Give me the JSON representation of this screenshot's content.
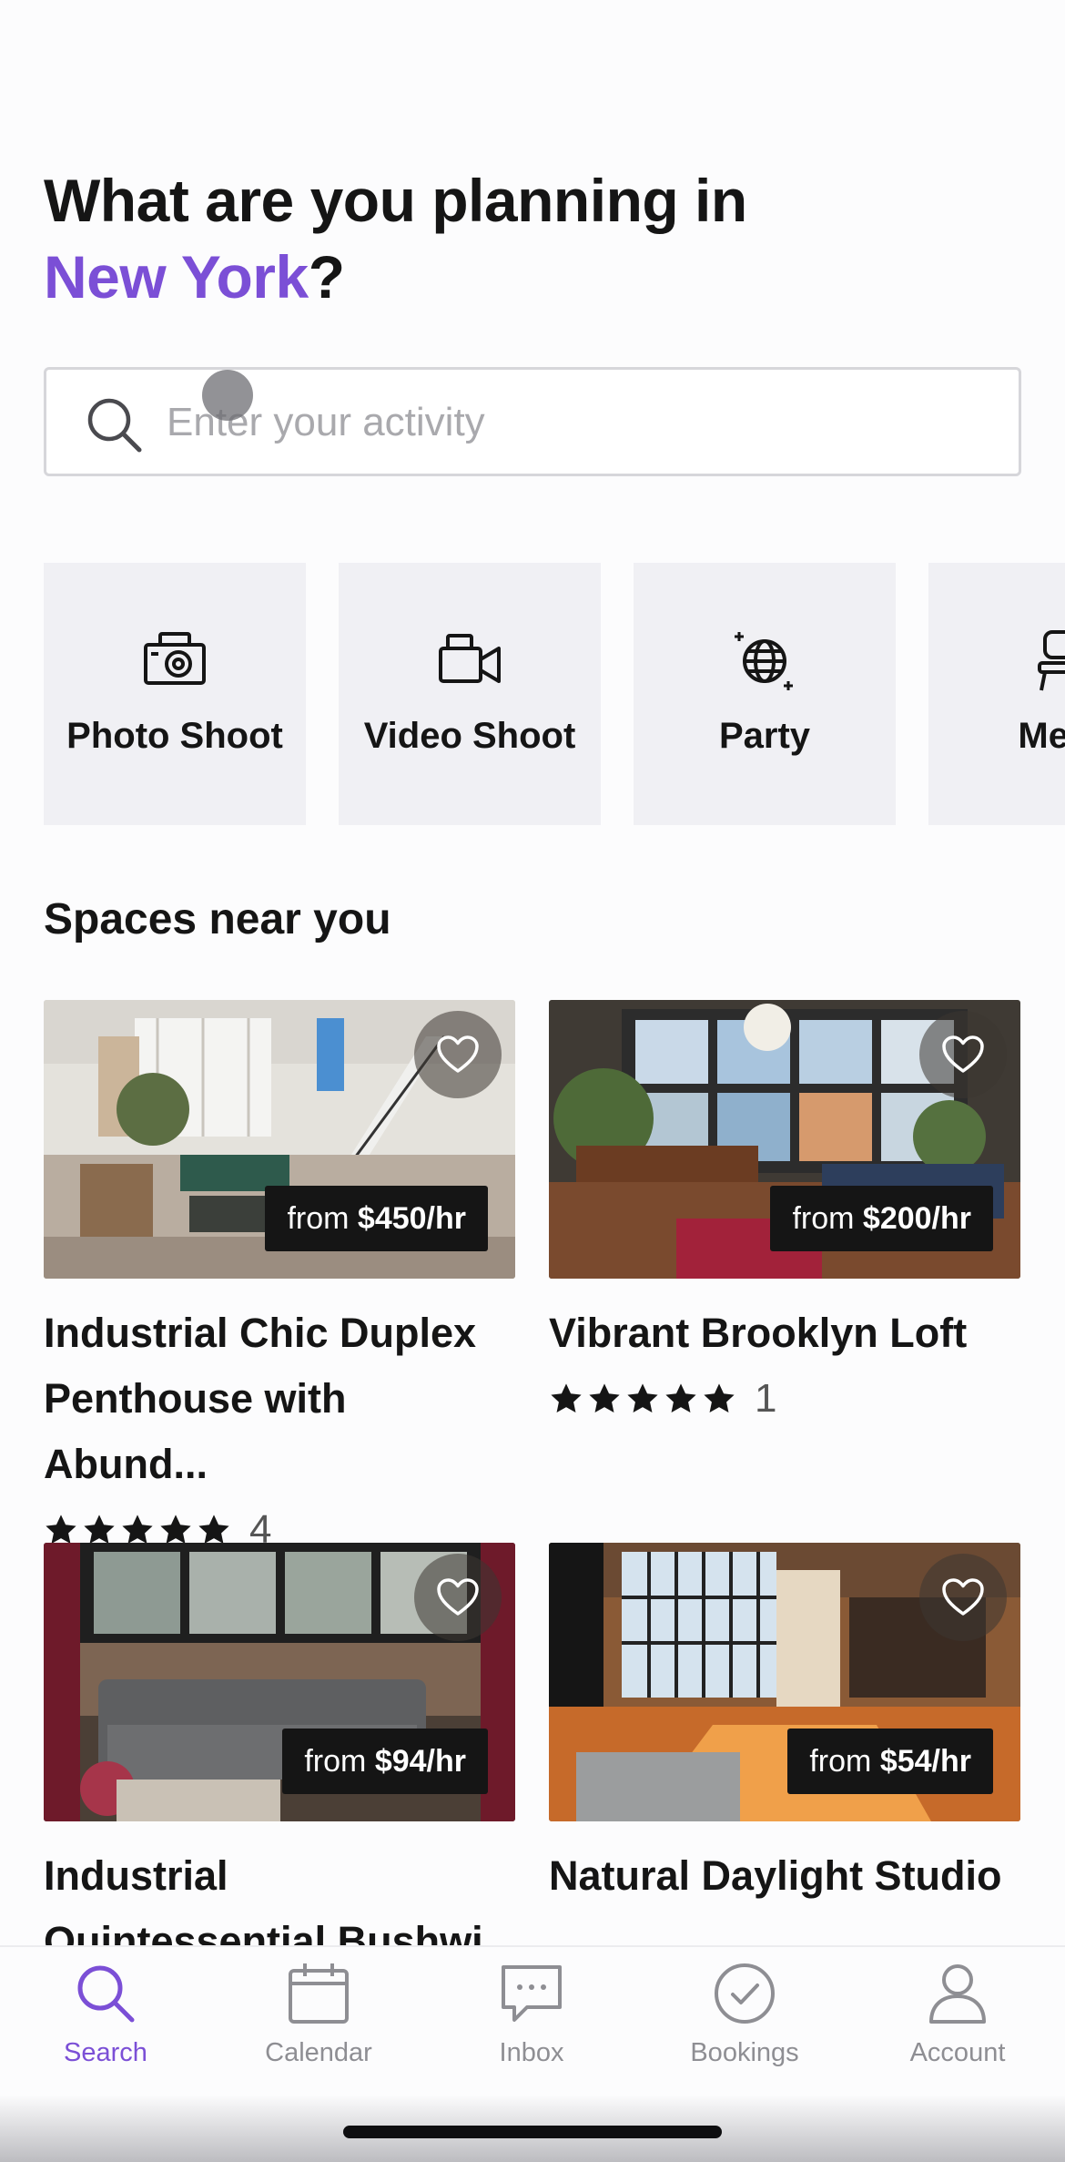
{
  "header": {
    "title_line1": "What are you planning in",
    "city": "New York",
    "question_mark": "?"
  },
  "search": {
    "placeholder": "Enter your activity",
    "value": ""
  },
  "categories": [
    {
      "label": "Photo Shoot",
      "icon": "camera-icon"
    },
    {
      "label": "Video Shoot",
      "icon": "video-camera-icon"
    },
    {
      "label": "Party",
      "icon": "disco-ball-icon"
    },
    {
      "label": "Meet",
      "icon": "chair-icon"
    }
  ],
  "section": {
    "title": "Spaces near you"
  },
  "listings": [
    {
      "title": "Industrial Chic Duplex Penthouse with Abund...",
      "price_prefix": "from",
      "price": "$450/hr",
      "rating": 5,
      "review_count": "4"
    },
    {
      "title": "Vibrant Brooklyn Loft",
      "price_prefix": "from",
      "price": "$200/hr",
      "rating": 5,
      "review_count": "1"
    },
    {
      "title": "Industrial Quintessential Bushwi",
      "price_prefix": "from",
      "price": "$94/hr",
      "rating": null,
      "review_count": ""
    },
    {
      "title": "Natural Daylight Studio",
      "price_prefix": "from",
      "price": "$54/hr",
      "rating": null,
      "review_count": ""
    }
  ],
  "tabbar": {
    "active": "Search",
    "tabs": [
      {
        "label": "Search",
        "icon": "search-icon"
      },
      {
        "label": "Calendar",
        "icon": "calendar-icon"
      },
      {
        "label": "Inbox",
        "icon": "chat-bubble-icon"
      },
      {
        "label": "Bookings",
        "icon": "check-circle-icon"
      },
      {
        "label": "Account",
        "icon": "person-icon"
      }
    ]
  },
  "colors": {
    "accent": "#7b4fd6",
    "text": "#151515",
    "muted": "#8e8e93",
    "tile_bg": "#f0f0f4"
  }
}
